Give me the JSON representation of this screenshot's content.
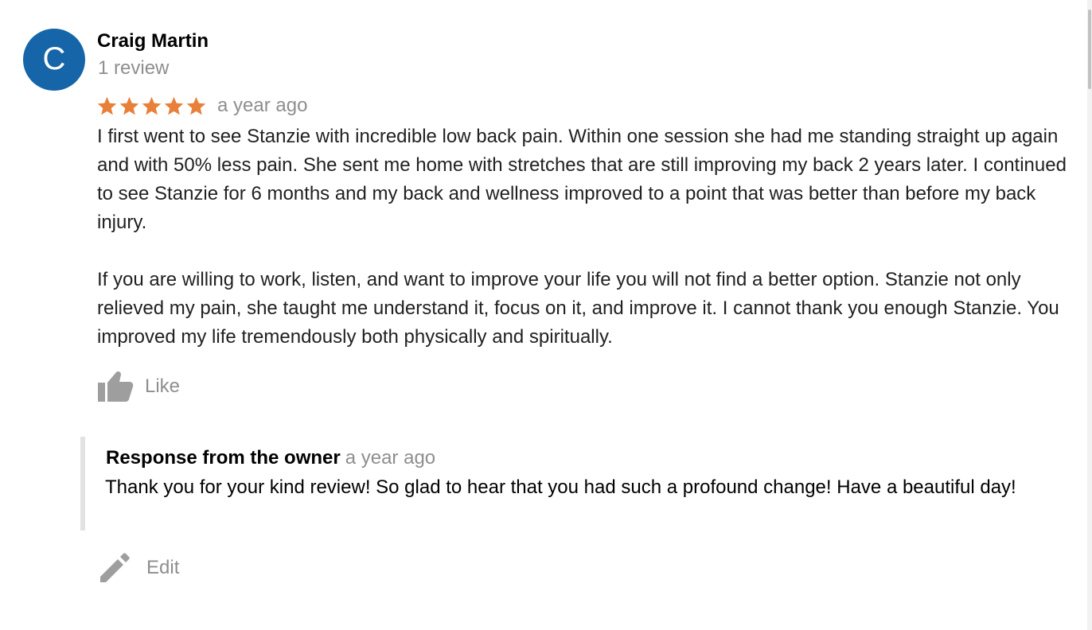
{
  "review": {
    "avatar_letter": "C",
    "avatar_color": "#1565a8",
    "reviewer_name": "Craig Martin",
    "review_count": "1 review",
    "rating": 5,
    "rating_max": 5,
    "star_color": "#e8803a",
    "date": "a year ago",
    "paragraphs": [
      "I first went to see Stanzie with incredible low back pain. Within one session she had me standing straight up again and with 50% less pain. She sent me home with stretches that are still improving my back 2 years later. I continued to see Stanzie for 6 months and my back and wellness improved to a point that was better than before my back injury.",
      "If you are willing to work, listen, and want to improve your life you will not find a better option. Stanzie not only relieved my pain, she taught me understand it, focus on it, and improve it. I cannot thank you enough Stanzie. You improved my life tremendously both physically and spiritually."
    ],
    "like_label": "Like",
    "like_icon": "thumbs-up-icon"
  },
  "owner_response": {
    "title": "Response from the owner",
    "date": "a year ago",
    "text": "Thank you for your kind review! So glad to hear that you had such a profound change! Have a beautiful day!"
  },
  "edit": {
    "label": "Edit",
    "icon": "pencil-icon"
  }
}
